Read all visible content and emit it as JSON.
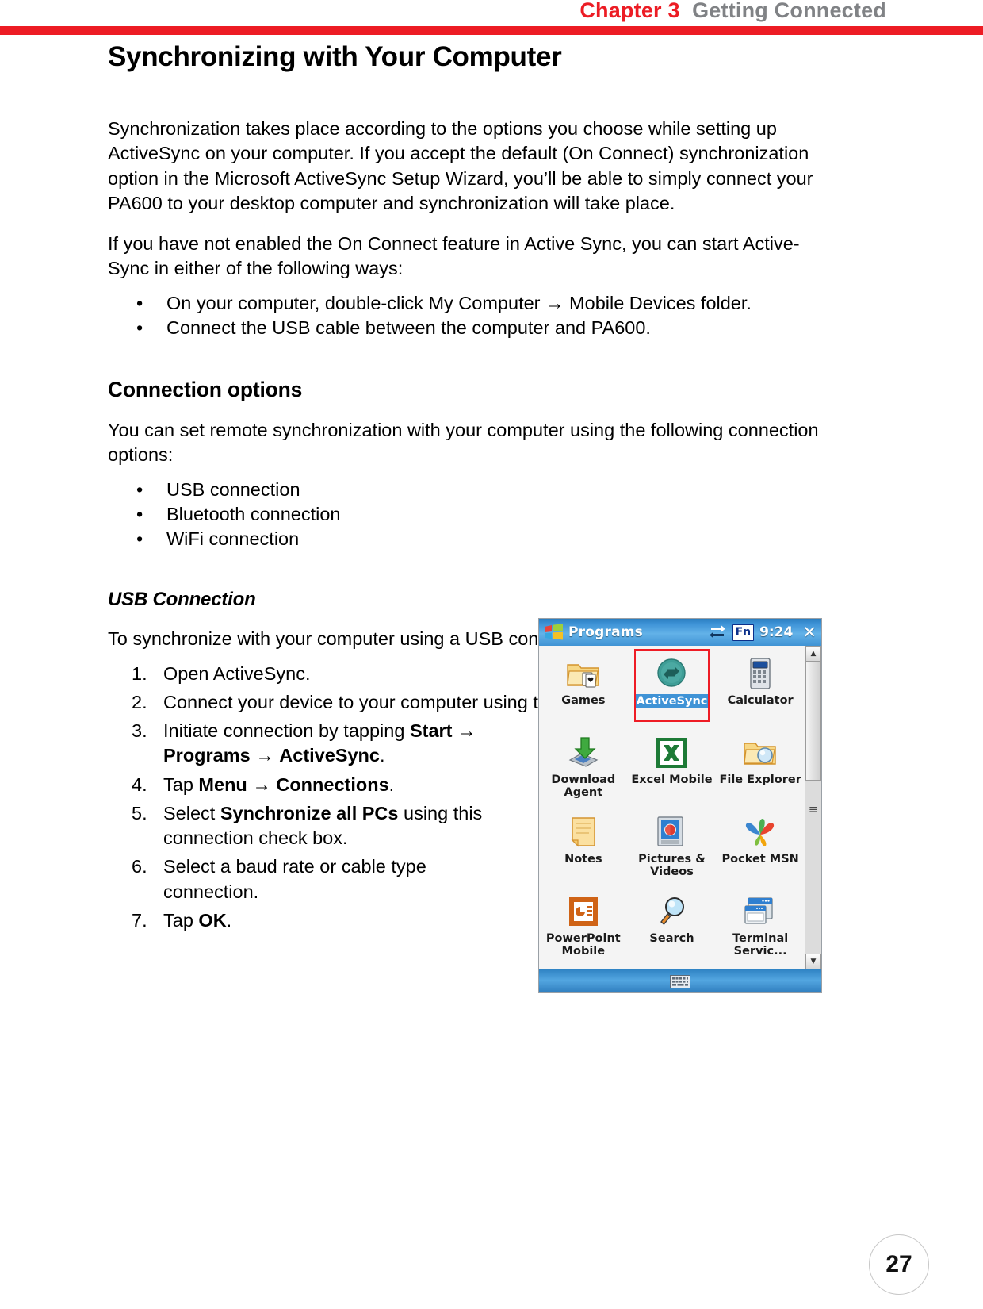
{
  "header": {
    "chapter": "Chapter 3",
    "title": "Getting Connected"
  },
  "page_title": "Synchronizing with Your Computer",
  "intro": {
    "para1": "Synchronization takes place according to the options you choose while setting up ActiveSync on your computer. If you accept the default (On Connect) synchronization option in the Microsoft ActiveSync Setup Wizard, you’ll be able to simply connect your PA600 to your desktop computer and synchronization will take place.",
    "para2": "If you have not enabled the On Connect feature in Active Sync, you can start Active-Sync in either of the following ways:",
    "bullets": [
      "On your computer, double-click My Computer → Mobile Devices folder.",
      "Connect the USB cable between the computer and PA600."
    ]
  },
  "connection_options": {
    "heading": "Connection options",
    "intro": "You can set remote synchronization with your computer using the following connection options:",
    "bullets": [
      "USB connection",
      "Bluetooth connection",
      "WiFi connection"
    ]
  },
  "usb_connection": {
    "heading": "USB Connection",
    "intro": "To synchronize with your computer using a USB connection:",
    "steps": [
      {
        "num": "1.",
        "parts": [
          {
            "t": "Open ActiveSync.",
            "b": false
          }
        ]
      },
      {
        "num": "2.",
        "parts": [
          {
            "t": "Connect your device to your computer using the USB charging cable.",
            "b": false
          }
        ]
      },
      {
        "num": "3.",
        "parts": [
          {
            "t": "Initiate connection by tapping ",
            "b": false
          },
          {
            "t": "Start",
            "b": true
          },
          {
            "t": " → ",
            "b": false
          },
          {
            "t": "Programs",
            "b": true
          },
          {
            "t": " → ",
            "b": false
          },
          {
            "t": "ActiveSync",
            "b": true
          },
          {
            "t": ".",
            "b": false
          }
        ]
      },
      {
        "num": "4.",
        "parts": [
          {
            "t": "Tap ",
            "b": false
          },
          {
            "t": "Menu",
            "b": true
          },
          {
            "t": " → ",
            "b": false
          },
          {
            "t": "Connections",
            "b": true
          },
          {
            "t": ".",
            "b": false
          }
        ]
      },
      {
        "num": "5.",
        "parts": [
          {
            "t": "Select ",
            "b": false
          },
          {
            "t": "Synchronize all PCs",
            "b": true
          },
          {
            "t": " using this connection check box.",
            "b": false
          }
        ]
      },
      {
        "num": "6.",
        "parts": [
          {
            "t": "Select a baud rate or cable type connection.",
            "b": false
          }
        ]
      },
      {
        "num": "7.",
        "parts": [
          {
            "t": "Tap ",
            "b": false
          },
          {
            "t": "OK",
            "b": true
          },
          {
            "t": ".",
            "b": false
          }
        ]
      }
    ]
  },
  "pda_screenshot": {
    "titlebar": {
      "start_icon": "windows-flag-icon",
      "title": "Programs",
      "connectivity_icon": "connectivity-icon",
      "fn_badge": "Fn",
      "clock": "9:24",
      "close_icon": "close-x-icon"
    },
    "apps": [
      {
        "label": "Games",
        "icon": "games-folder-icon",
        "selected": false
      },
      {
        "label": "ActiveSync",
        "icon": "activesync-icon",
        "selected": true
      },
      {
        "label": "Calculator",
        "icon": "calculator-icon",
        "selected": false
      },
      {
        "label": "Download Agent",
        "icon": "download-agent-icon",
        "selected": false
      },
      {
        "label": "Excel Mobile",
        "icon": "excel-mobile-icon",
        "selected": false
      },
      {
        "label": "File Explorer",
        "icon": "file-explorer-icon",
        "selected": false
      },
      {
        "label": "Notes",
        "icon": "notes-icon",
        "selected": false
      },
      {
        "label": "Pictures & Videos",
        "icon": "pictures-videos-icon",
        "selected": false
      },
      {
        "label": "Pocket MSN",
        "icon": "pocket-msn-icon",
        "selected": false
      },
      {
        "label": "PowerPoint Mobile",
        "icon": "powerpoint-mobile-icon",
        "selected": false
      },
      {
        "label": "Search",
        "icon": "search-icon",
        "selected": false
      },
      {
        "label": "Terminal Servic...",
        "icon": "terminal-services-icon",
        "selected": false
      }
    ],
    "scrollbar": {
      "up_arrow": "▲",
      "down_arrow": "▼",
      "grip": "≡"
    },
    "taskbar": {
      "keyboard_icon": "keyboard-icon"
    },
    "highlight_color": "#ee1c25",
    "selection_color": "#3f93d6"
  },
  "page_number": "27"
}
